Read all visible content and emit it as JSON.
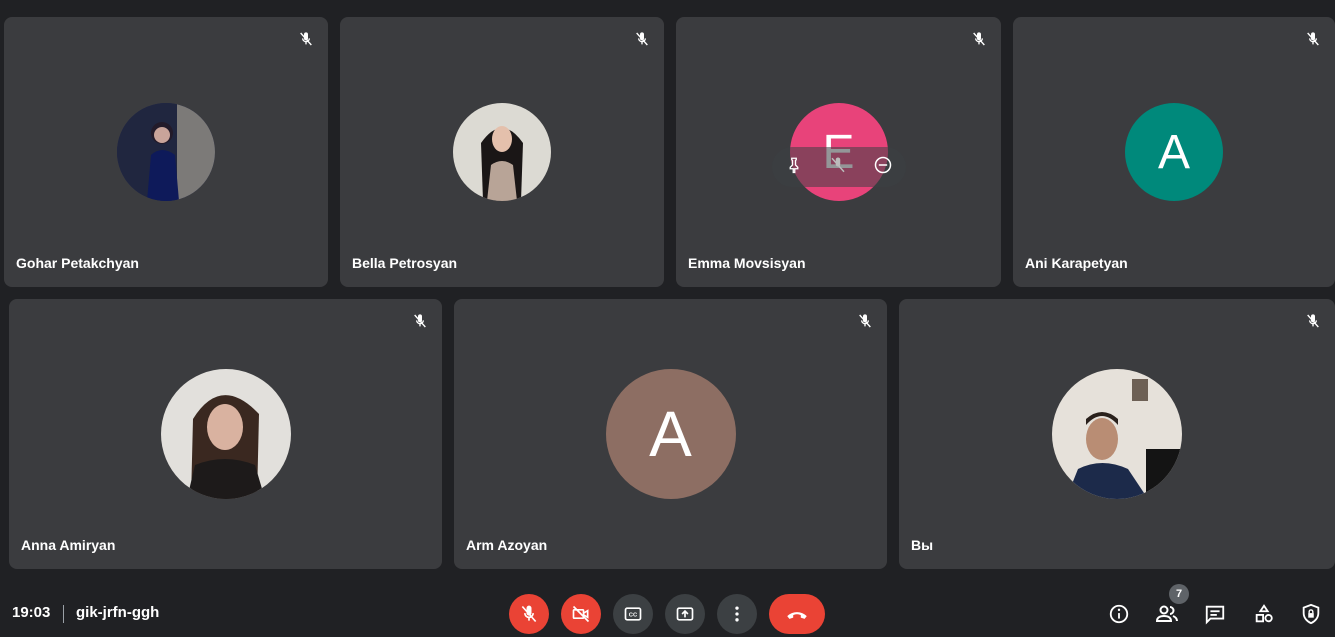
{
  "participants": [
    {
      "name": "Gohar Petakchyan",
      "avatar_type": "photo",
      "muted": true
    },
    {
      "name": "Bella Petrosyan",
      "avatar_type": "photo",
      "muted": true
    },
    {
      "name": "Emma Movsisyan",
      "avatar_type": "letter",
      "letter": "E",
      "color": "#e8437a",
      "muted": true,
      "hover_controls": [
        "pin-icon",
        "mute-icon",
        "remove-icon"
      ]
    },
    {
      "name": "Ani Karapetyan",
      "avatar_type": "letter",
      "letter": "A",
      "color": "#00897b",
      "muted": true
    },
    {
      "name": "Anna Amiryan",
      "avatar_type": "photo",
      "muted": true
    },
    {
      "name": "Arm Azoyan",
      "avatar_type": "letter",
      "letter": "A",
      "color": "#8d6e63",
      "muted": true
    },
    {
      "name": "Вы",
      "avatar_type": "photo",
      "muted": true
    }
  ],
  "bottombar": {
    "time": "19:03",
    "meeting_code": "gik-jrfn-ggh",
    "people_count": "7",
    "colors": {
      "danger": "#ea4335",
      "control": "#3c4043"
    }
  }
}
